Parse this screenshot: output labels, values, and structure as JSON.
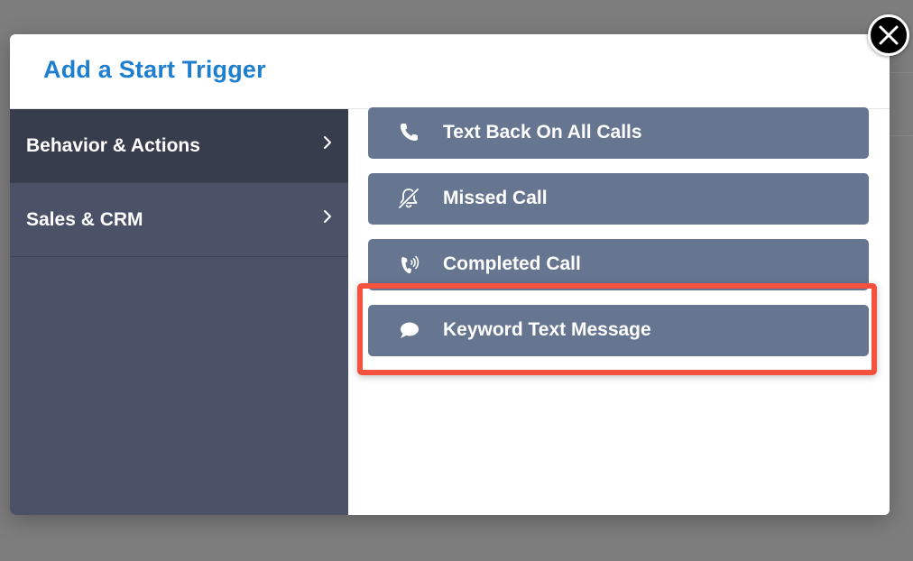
{
  "modal": {
    "title": "Add a Start Trigger",
    "close_icon": "close-icon"
  },
  "sidebar": {
    "items": [
      {
        "label": "Behavior & Actions",
        "icon": "chevron-right-icon",
        "active": true
      },
      {
        "label": "Sales & CRM",
        "icon": "chevron-right-icon",
        "active": false
      }
    ]
  },
  "triggers": [
    {
      "label": "Text Back On All Calls",
      "icon": "phone-icon"
    },
    {
      "label": "Missed Call",
      "icon": "bell-slash-icon"
    },
    {
      "label": "Completed Call",
      "icon": "phone-volume-icon"
    },
    {
      "label": "Keyword Text Message",
      "icon": "comment-icon",
      "highlighted": true
    }
  ],
  "colors": {
    "title": "#1f7fcf",
    "sidebar": "#4b5268",
    "sidebar_active": "#383d4e",
    "trigger_button": "#677690",
    "highlight": "#f4513f"
  }
}
